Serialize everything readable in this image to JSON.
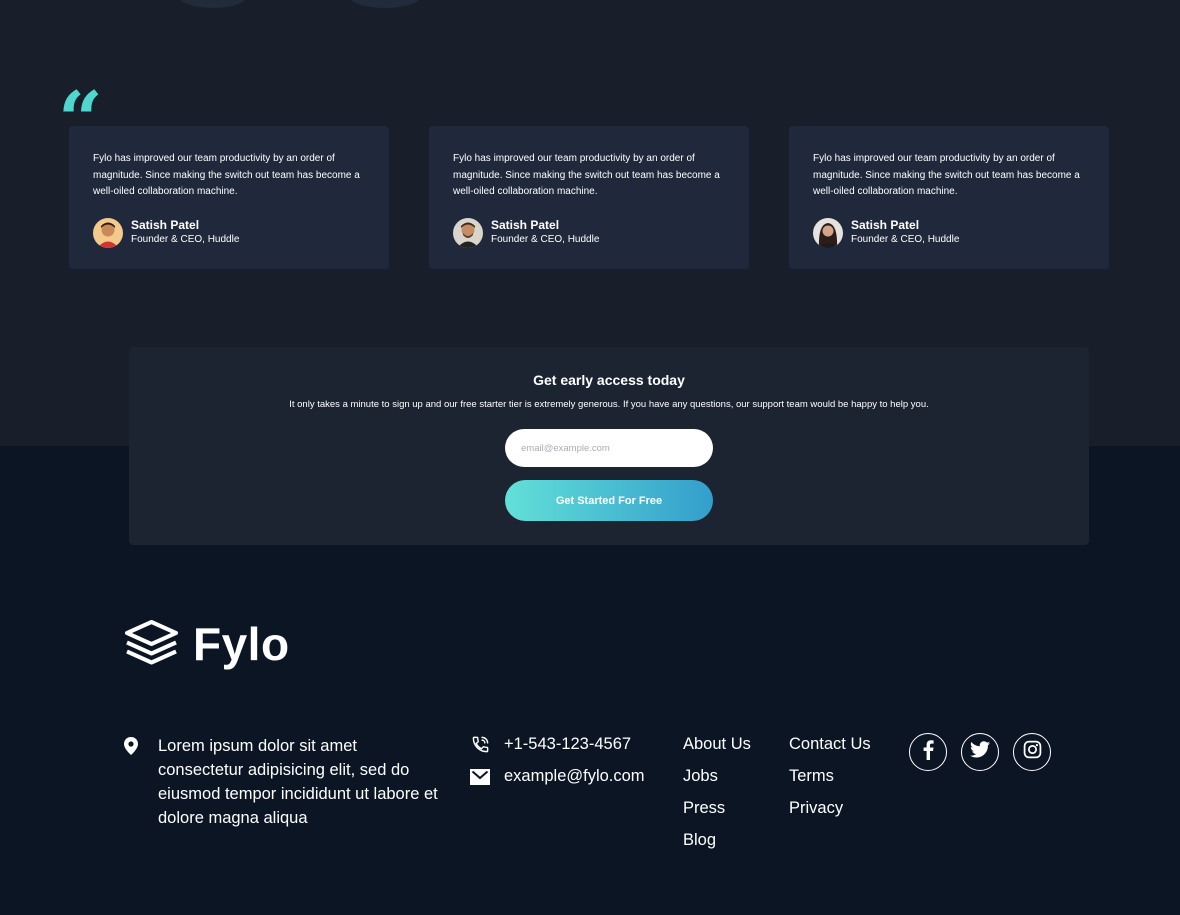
{
  "testimonials": [
    {
      "text": "Fylo has improved our team productivity by an order of magnitude. Since making the switch out team has become a well-oiled collaboration machine.",
      "name": "Satish Patel",
      "role": "Founder & CEO, Huddle"
    },
    {
      "text": "Fylo has improved our team productivity by an order of magnitude. Since making the switch out team has become a well-oiled collaboration machine.",
      "name": "Satish Patel",
      "role": "Founder & CEO, Huddle"
    },
    {
      "text": "Fylo has improved our team productivity by an order of magnitude. Since making the switch out team has become a well-oiled collaboration machine.",
      "name": "Satish Patel",
      "role": "Founder & CEO, Huddle"
    }
  ],
  "early_access": {
    "title": "Get early access today",
    "description": "It only takes a minute to sign up and our free starter tier is extremely generous. If you have any questions, our support team would be happy to help you.",
    "email_placeholder": "email@example.com",
    "button_label": "Get Started For Free"
  },
  "footer": {
    "logo_text": "Fylo",
    "address": "Lorem ipsum dolor sit amet consectetur adipisicing elit, sed do eiusmod tempor incididunt ut labore et dolore magna aliqua",
    "phone": "+1-543-123-4567",
    "email": "example@fylo.com",
    "links_col1": [
      "About Us",
      "Jobs",
      "Press",
      "Blog"
    ],
    "links_col2": [
      "Contact Us",
      "Terms",
      "Privacy"
    ],
    "social_icons": [
      "facebook-icon",
      "twitter-icon",
      "instagram-icon"
    ]
  },
  "colors": {
    "top_background": "#181f2a",
    "footer_background": "#0c1524",
    "card_background": "#20293c",
    "accent_cyan": "#4fd6cf",
    "button_gradient_start": "#62e0d8",
    "button_gradient_end": "#339ecc"
  }
}
